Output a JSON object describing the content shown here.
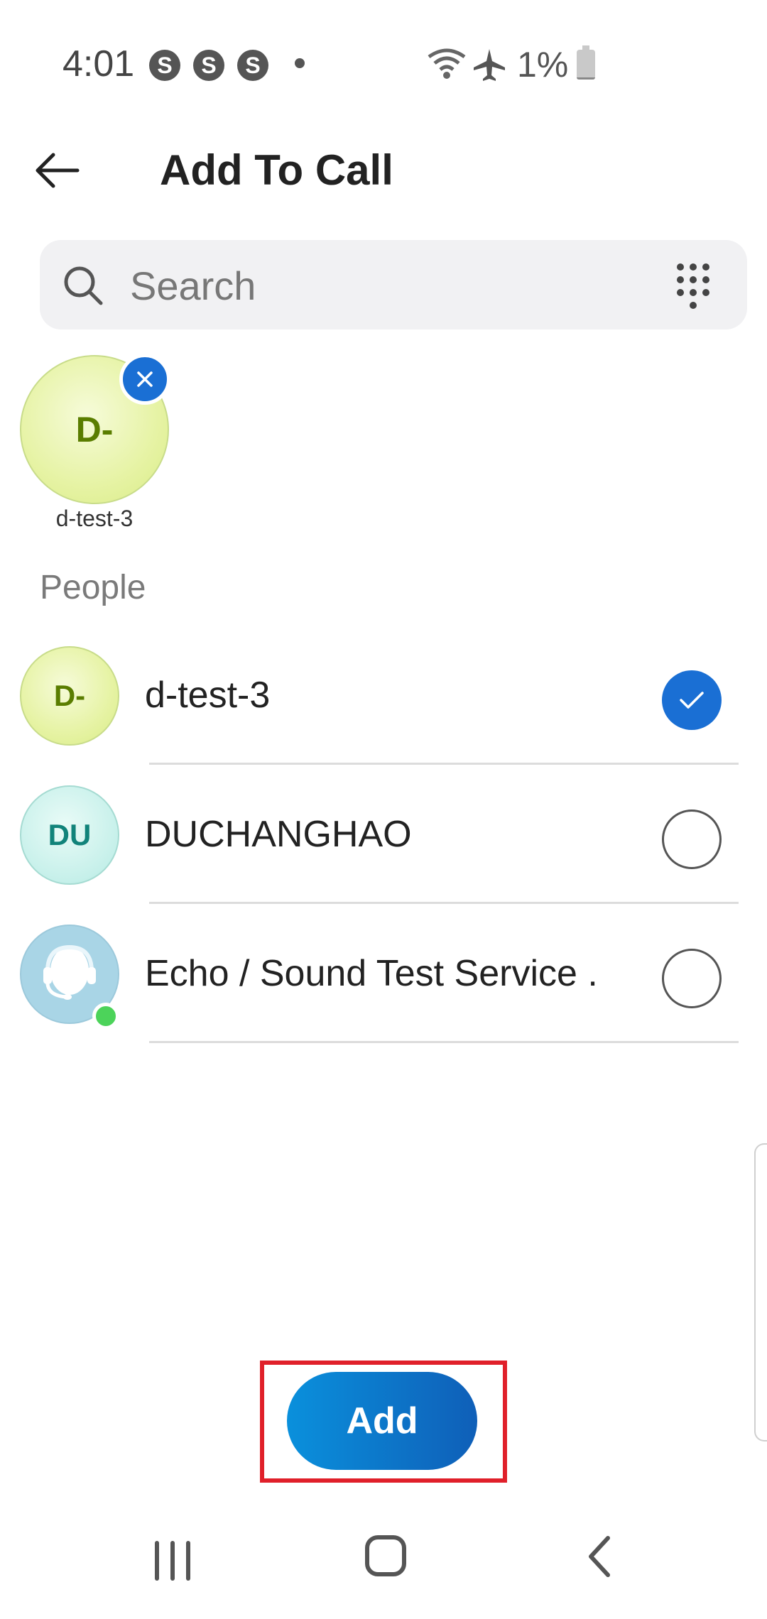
{
  "status_bar": {
    "time": "4:01",
    "notification_icons": [
      "S",
      "S",
      "S"
    ],
    "battery_percent": "1%"
  },
  "header": {
    "title": "Add To Call"
  },
  "search": {
    "placeholder": "Search"
  },
  "selected": [
    {
      "initials": "D-",
      "name": "d-test-3"
    }
  ],
  "section": {
    "people_label": "People"
  },
  "people": [
    {
      "initials": "D-",
      "name": "d-test-3",
      "selected": true
    },
    {
      "initials": "DU",
      "name": "DUCHANGHAO",
      "selected": false
    },
    {
      "initials": "",
      "name": "Echo / Sound Test Service .",
      "selected": false,
      "online": true
    }
  ],
  "footer": {
    "add_label": "Add"
  },
  "colors": {
    "accent": "#1a6fd4",
    "highlight_box": "#e0202a",
    "presence_online": "#4cd35a"
  }
}
